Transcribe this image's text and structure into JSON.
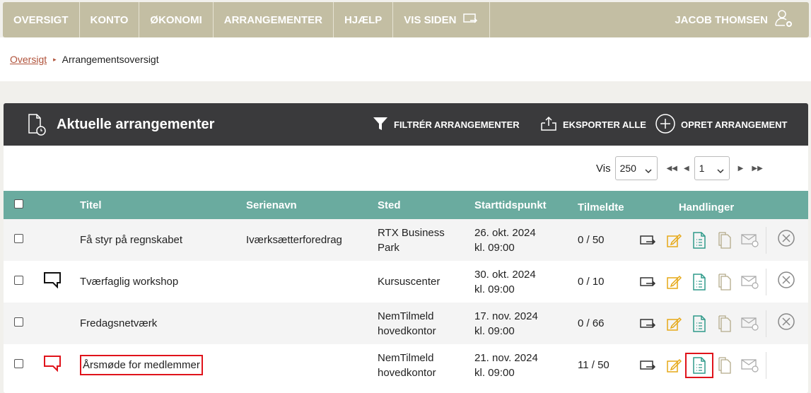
{
  "nav": {
    "items": [
      "OVERSIGT",
      "KONTO",
      "ØKONOMI",
      "ARRANGEMENTER",
      "HJÆLP",
      "VIS SIDEN"
    ],
    "user": "JACOB THOMSEN"
  },
  "breadcrumb": {
    "home": "Oversigt",
    "current": "Arrangementsoversigt"
  },
  "panel": {
    "title": "Aktuelle arrangementer",
    "filter_label": "FILTRÉR ARRANGEMENTER",
    "export_label": "EKSPORTER ALLE",
    "create_label": "OPRET ARRANGEMENT"
  },
  "pager": {
    "show_label": "Vis",
    "per_page": "250",
    "page": "1"
  },
  "table": {
    "headers": [
      "Titel",
      "Serienavn",
      "Sted",
      "Starttidspunkt",
      "Tilmeldte",
      "Handlinger"
    ],
    "rows": [
      {
        "title": "Få styr på regnskabet",
        "series": "Iværksætterforedrag",
        "place1": "RTX Business",
        "place2": "Park",
        "date": "26. okt. 2024",
        "time": "kl. 09:00",
        "count": "0 / 50",
        "comment": "none"
      },
      {
        "title": "Tværfaglig workshop",
        "series": "",
        "place1": "Kursuscenter",
        "place2": "",
        "date": "30. okt. 2024",
        "time": "kl. 09:00",
        "count": "0 / 10",
        "comment": "black"
      },
      {
        "title": "Fredagsnetværk",
        "series": "",
        "place1": "NemTilmeld",
        "place2": "hovedkontor",
        "date": "17. nov. 2024",
        "time": "kl. 09:00",
        "count": "0 / 66",
        "comment": "none"
      },
      {
        "title": "Årsmøde for medlemmer",
        "series": "",
        "place1": "NemTilmeld",
        "place2": "hovedkontor",
        "date": "21. nov. 2024",
        "time": "kl. 09:00",
        "count": "11 / 50",
        "comment": "red"
      }
    ]
  },
  "colors": {
    "nav": "#c3bea3",
    "header": "#3a3a3c",
    "table_head": "#6aab9f",
    "accent": "#b0523a",
    "highlight": "#e0131b"
  }
}
